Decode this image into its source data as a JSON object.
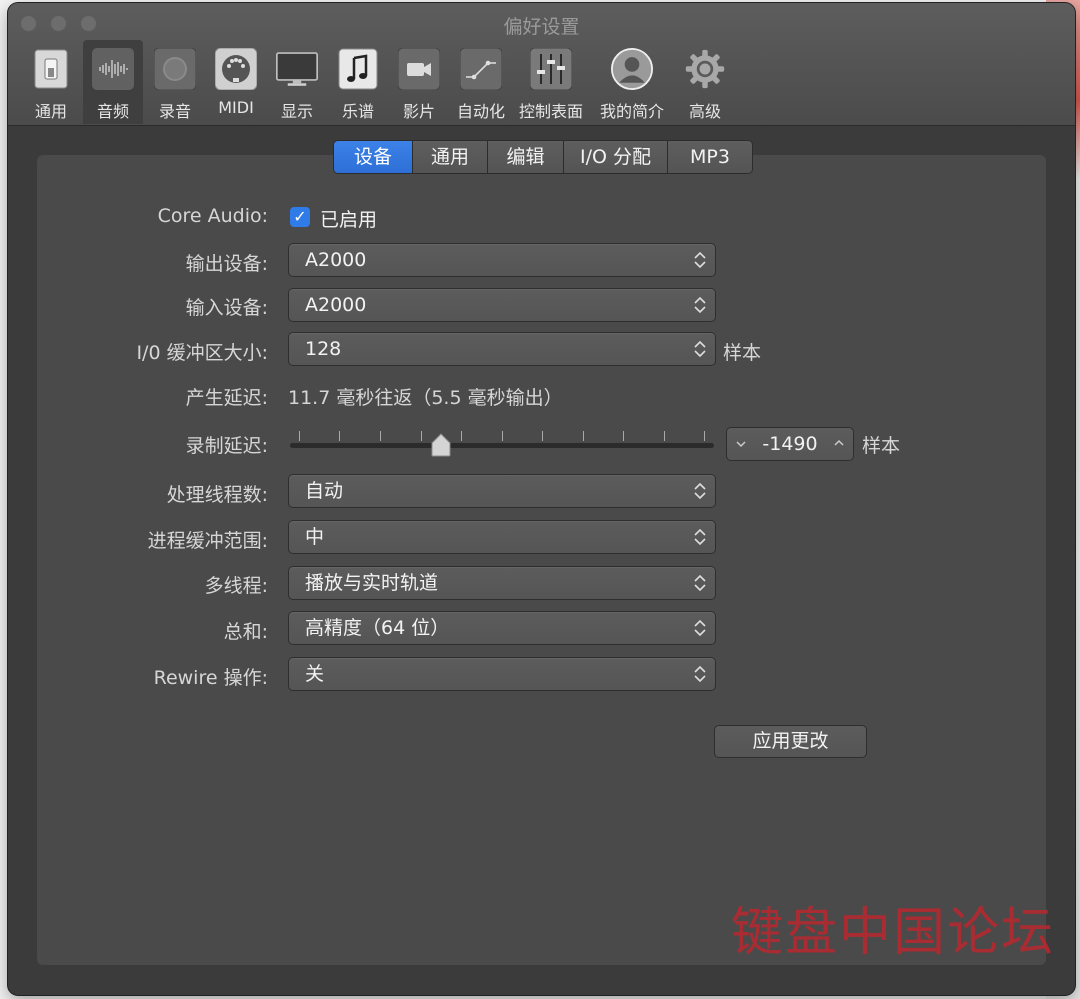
{
  "window": {
    "title": "偏好设置"
  },
  "toolbar": {
    "items": [
      {
        "label": "通用",
        "icon": "switch-icon"
      },
      {
        "label": "音频",
        "icon": "waveform-icon"
      },
      {
        "label": "录音",
        "icon": "record-icon"
      },
      {
        "label": "MIDI",
        "icon": "midi-port-icon"
      },
      {
        "label": "显示",
        "icon": "monitor-icon"
      },
      {
        "label": "乐谱",
        "icon": "music-note-icon"
      },
      {
        "label": "影片",
        "icon": "video-camera-icon"
      },
      {
        "label": "自动化",
        "icon": "automation-curve-icon"
      },
      {
        "label": "控制表面",
        "icon": "mixer-faders-icon"
      },
      {
        "label": "我的简介",
        "icon": "user-profile-icon"
      },
      {
        "label": "高级",
        "icon": "gear-icon"
      }
    ],
    "active_index": 1
  },
  "tabs": [
    {
      "label": "设备",
      "active": true
    },
    {
      "label": "通用",
      "active": false
    },
    {
      "label": "编辑",
      "active": false
    },
    {
      "label": "I/O 分配",
      "active": false
    },
    {
      "label": "MP3",
      "active": false
    }
  ],
  "settings": {
    "core_audio": {
      "label": "Core Audio:",
      "checkbox_label": "已启用",
      "checked": true
    },
    "output_device": {
      "label": "输出设备:",
      "value": "A2000"
    },
    "input_device": {
      "label": "输入设备:",
      "value": "A2000"
    },
    "io_buffer": {
      "label": "I/0 缓冲区大小:",
      "value": "128",
      "unit": "样本"
    },
    "latency": {
      "label": "产生延迟:",
      "value": "11.7 毫秒往返（5.5 毫秒输出）"
    },
    "record_delay": {
      "label": "录制延迟:",
      "value": "-1490",
      "unit": "样本",
      "slider_fraction": 0.36
    },
    "process_threads": {
      "label": "处理线程数:",
      "value": "自动"
    },
    "process_buffer": {
      "label": "进程缓冲范围:",
      "value": "中"
    },
    "multithreading": {
      "label": "多线程:",
      "value": "播放与实时轨道"
    },
    "summing": {
      "label": "总和:",
      "value": "高精度（64 位）"
    },
    "rewire": {
      "label": "Rewire 操作:",
      "value": "关"
    }
  },
  "apply_button": "应用更改",
  "watermark": "键盘中国论坛",
  "colors": {
    "accent": "#2f7be8",
    "window_bg": "#3b3b3b",
    "panel_bg": "#4a4a4a",
    "watermark": "#c0262e"
  }
}
